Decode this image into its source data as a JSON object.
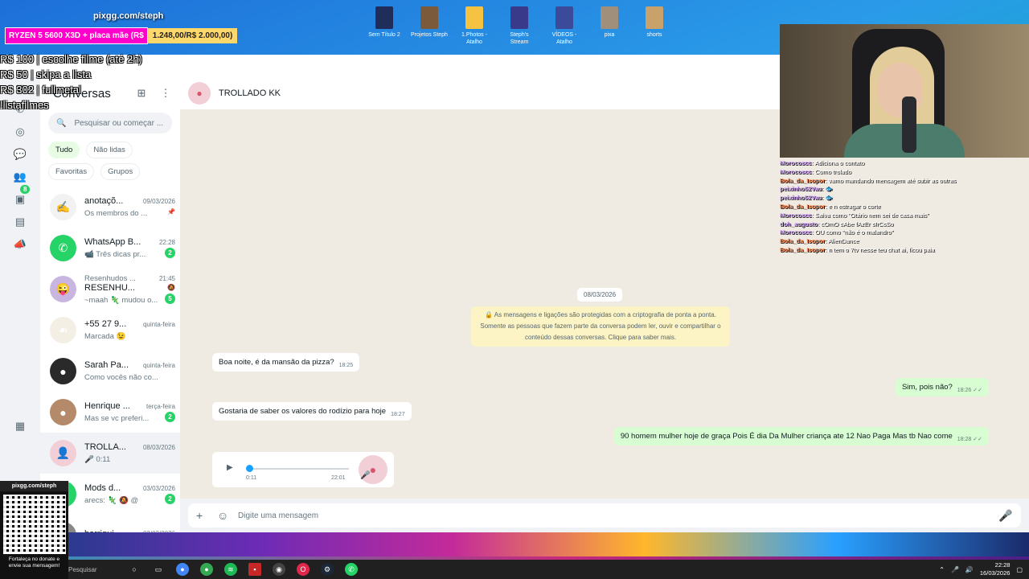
{
  "desktop": {
    "icons": [
      {
        "label": "Sem Título 2",
        "color": "#1e2d5a"
      },
      {
        "label": "Projetos Steph",
        "color": "#7a5a3a"
      },
      {
        "label": "1.Photos - Atalho",
        "color": "#f5c242"
      },
      {
        "label": "Steph's Stream",
        "color": "#3a3a8a"
      },
      {
        "label": "VÍDEOS - Atalho",
        "color": "#3c4a9a"
      },
      {
        "label": "pixa",
        "color": "#a08f7a"
      },
      {
        "label": "shorts",
        "color": "#c9a26b"
      }
    ]
  },
  "overlay": {
    "handle": "pixgg.com/steph",
    "promo_left": "RYZEN 5 5600 X3D + placa mãe (R$",
    "promo_right": "1.248,00/R$ 2.000,00)",
    "donations": [
      "R$ 100 | escolhe filme (até 2h)",
      "R$ 50 | skipa a lista",
      "R$ 302 | fullmetal",
      "!listafilmes"
    ]
  },
  "sidebar": {
    "title": "Conversas",
    "search_placeholder": "Pesquisar ou começar ...",
    "filters": [
      "Tudo",
      "Não lidas",
      "Favoritas",
      "Grupos"
    ],
    "rail_badge": "8",
    "chats": [
      {
        "name": "anotaçõ...",
        "time": "09/03/2026",
        "preview": "Os membros do ...",
        "avatar": "#f2f2f2",
        "glyph": "✍",
        "badge": "",
        "pin": "📌"
      },
      {
        "name": "WhatsApp B...",
        "time": "22:28",
        "preview": "📹 Três dicas pr...",
        "avatar": "#25d366",
        "glyph": "✆",
        "badge": "2",
        "pin": ""
      },
      {
        "name": "RESENHU...",
        "time": "21:45",
        "preview": "~maah 🦎 mudou o...",
        "sender": "Resenhudos ...",
        "avatar": "#c9b6e0",
        "glyph": "😜",
        "badge": "5",
        "pin": "🔕"
      },
      {
        "name": "+55 27 9...",
        "time": "quinta-feira",
        "preview": "Marcada 😉",
        "avatar": "#f4efe4",
        "glyph": "☙",
        "badge": "",
        "pin": ""
      },
      {
        "name": "Sarah Pa...",
        "time": "quinta-feira",
        "preview": "Como vocês não co...",
        "avatar": "#2a2a2a",
        "glyph": "●",
        "badge": "",
        "pin": ""
      },
      {
        "name": "Henrique ...",
        "time": "terça-feira",
        "preview": "Mas se vc preferi...",
        "avatar": "#b58a6a",
        "glyph": "●",
        "badge": "2",
        "pin": ""
      },
      {
        "name": "TROLLA...",
        "time": "08/03/2026",
        "preview": "🎤 0:11",
        "avatar": "#f2cfd6",
        "glyph": "👤",
        "badge": "",
        "pin": ""
      },
      {
        "name": "Mods d...",
        "time": "03/03/2026",
        "preview": "arecs: 🦎 🔕 @",
        "avatar": "#25d366",
        "glyph": "●",
        "badge": "2",
        "pin": ""
      },
      {
        "name": "barrigui...",
        "time": "02/03/2026",
        "preview": "",
        "avatar": "#888",
        "glyph": "●",
        "badge": "",
        "pin": ""
      }
    ]
  },
  "chat": {
    "name": "TROLLADO KK",
    "date_chip": "08/03/2026",
    "encryption_notice": "🔒 As mensagens e ligações são protegidas com a criptografia de ponta a ponta. Somente as pessoas que fazem parte da conversa podem ler, ouvir e compartilhar o conteúdo dessas conversas. Clique para saber mais.",
    "messages": [
      {
        "dir": "in",
        "text": "Boa noite, é da mansão da pizza?",
        "time": "18:25"
      },
      {
        "dir": "out",
        "text": "Sim, pois não?",
        "time": "18:26 ✓✓"
      },
      {
        "dir": "in",
        "text": "Gostaria de saber os valores do rodízio para hoje",
        "time": "18:27"
      },
      {
        "dir": "out",
        "text": "90 homem mulher hoje de graça Pois É dia Da Mulher criança ate 12 Nao Paga Mas tb Nao come",
        "time": "18:28 ✓✓"
      }
    ],
    "voice": {
      "current": "0:11",
      "sent": "22:01",
      "progress": 0
    },
    "composer_placeholder": "Digite uma mensagem"
  },
  "twitch_chat": [
    {
      "user": "Morocoscc",
      "text": "Adiciona o contato"
    },
    {
      "user": "Morocoscc",
      "text": "Como trolado"
    },
    {
      "user": "Bola_da_Isopor",
      "text": "vamo mandando mensagem até subir as outras"
    },
    {
      "user": "peixinho52Vau",
      "text": "🐟"
    },
    {
      "user": "peixinho52Vau",
      "text": "🐟"
    },
    {
      "user": "Bola_da_Isopor",
      "text": "e n estragar o corte"
    },
    {
      "user": "Morocoscc",
      "text": "Salva como \"Otário nem sei de casa mais\""
    },
    {
      "user": "doh_augusto",
      "text": "cOmO sAbe fAzEr sIrCsSo"
    },
    {
      "user": "Morocoscc",
      "text": "OU como \"não é o malandro\""
    },
    {
      "user": "Bola_da_Isopor",
      "text": "AlienDance"
    },
    {
      "user": "Bola_da_Isopor",
      "text": "n tem o 7tv nesse teu chat ai, ficou paia"
    }
  ],
  "qr": {
    "handle": "pixgg.com/steph",
    "caption": "Fortaleça no donate e envie sua mensagem!"
  },
  "taskbar": {
    "search": "Pesquisar",
    "time": "22:28",
    "date": "16/03/2026"
  }
}
